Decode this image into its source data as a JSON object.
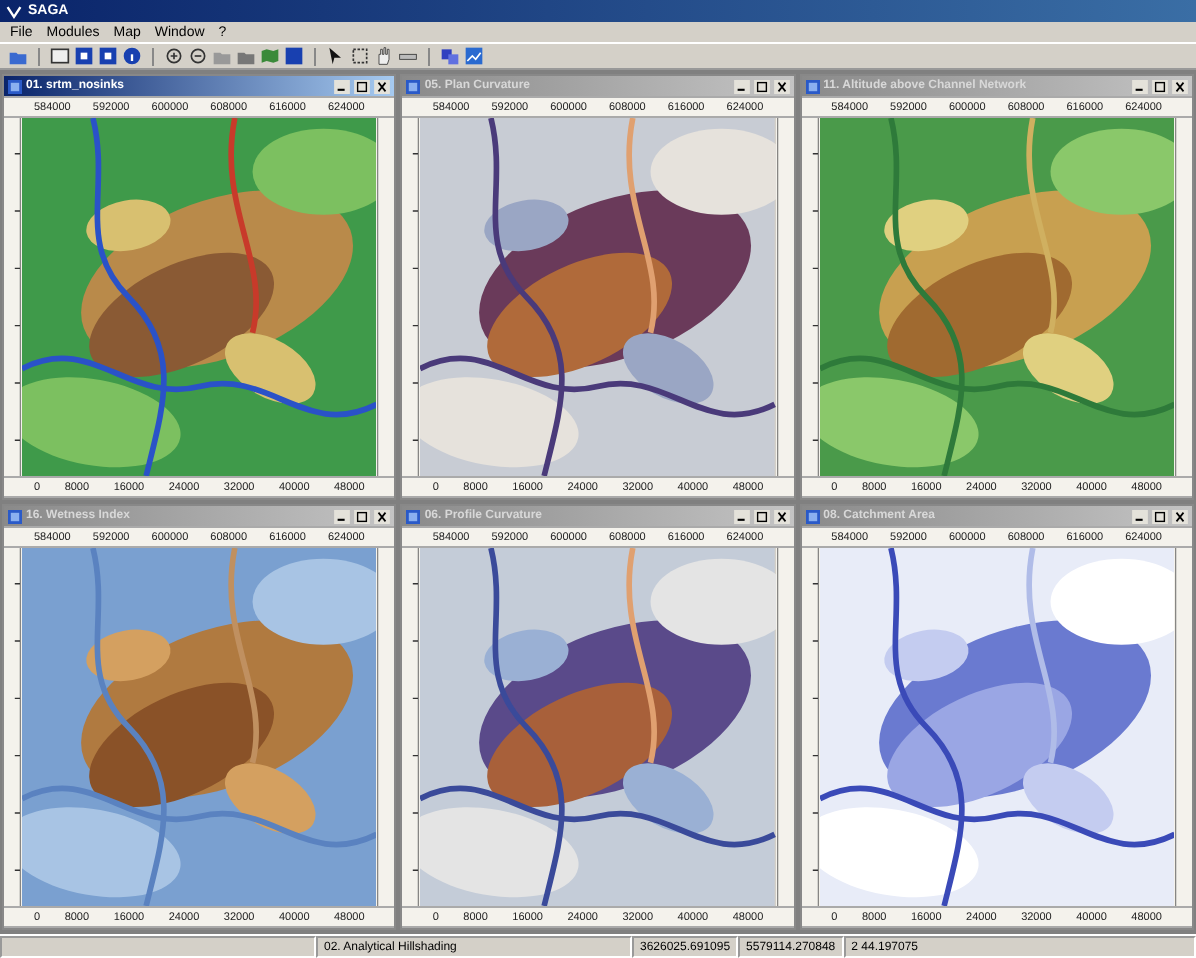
{
  "app": {
    "title": "SAGA"
  },
  "menu": [
    "File",
    "Modules",
    "Map",
    "Window",
    "?"
  ],
  "map_windows": [
    {
      "title": "01. srtm_nosinks",
      "selected": true,
      "top_ticks": [
        "584000",
        "592000",
        "600000",
        "608000",
        "616000",
        "624000"
      ],
      "bottom_ticks": [
        "0",
        "8000",
        "16000",
        "24000",
        "32000",
        "40000",
        "48000"
      ]
    },
    {
      "title": "05. Plan Curvature",
      "selected": false,
      "top_ticks": [
        "584000",
        "592000",
        "600000",
        "608000",
        "616000",
        "624000"
      ],
      "bottom_ticks": [
        "0",
        "8000",
        "16000",
        "24000",
        "32000",
        "40000",
        "48000"
      ]
    },
    {
      "title": "11. Altitude above Channel Network",
      "selected": false,
      "top_ticks": [
        "584000",
        "592000",
        "600000",
        "608000",
        "616000",
        "624000"
      ],
      "bottom_ticks": [
        "0",
        "8000",
        "16000",
        "24000",
        "32000",
        "40000",
        "48000"
      ]
    },
    {
      "title": "16. Wetness Index",
      "selected": false,
      "top_ticks": [
        "584000",
        "592000",
        "600000",
        "608000",
        "616000",
        "624000"
      ],
      "bottom_ticks": [
        "0",
        "8000",
        "16000",
        "24000",
        "32000",
        "40000",
        "48000"
      ]
    },
    {
      "title": "06. Profile Curvature",
      "selected": false,
      "top_ticks": [
        "584000",
        "592000",
        "600000",
        "608000",
        "616000",
        "624000"
      ],
      "bottom_ticks": [
        "0",
        "8000",
        "16000",
        "24000",
        "32000",
        "40000",
        "48000"
      ]
    },
    {
      "title": "08. Catchment Area",
      "selected": false,
      "top_ticks": [
        "584000",
        "592000",
        "600000",
        "608000",
        "616000",
        "624000"
      ],
      "bottom_ticks": [
        "0",
        "8000",
        "16000",
        "24000",
        "32000",
        "40000",
        "48000"
      ]
    }
  ],
  "status_bar": [
    "02. Analytical Hillshading",
    "3626025.691095",
    "5579114.270848",
    "2 44.197075"
  ]
}
